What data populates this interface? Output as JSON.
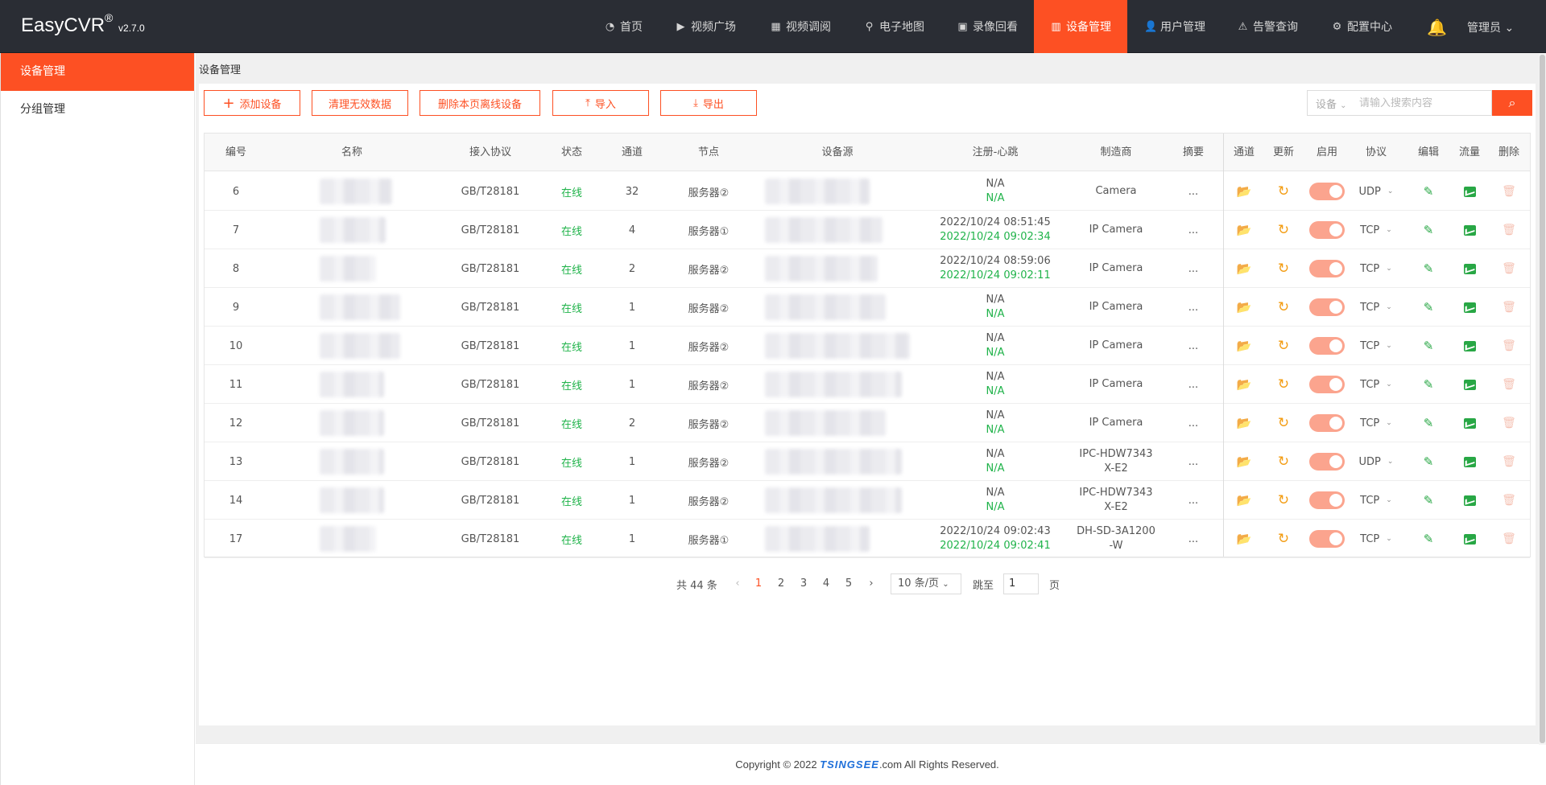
{
  "app": {
    "name": "EasyCVR",
    "reg": "®",
    "version": "v2.7.0"
  },
  "nav": [
    {
      "label": "首页",
      "icon": "dashboard-icon",
      "glyph": "◔"
    },
    {
      "label": "视频广场",
      "icon": "play-circle-icon",
      "glyph": "▶"
    },
    {
      "label": "视频调阅",
      "icon": "grid-view-icon",
      "glyph": "▦"
    },
    {
      "label": "电子地图",
      "icon": "map-pin-icon",
      "glyph": "⚲"
    },
    {
      "label": "录像回看",
      "icon": "video-camera-icon",
      "glyph": "▣"
    },
    {
      "label": "设备管理",
      "icon": "device-list-icon",
      "glyph": "▥",
      "active": true
    },
    {
      "label": "用户管理",
      "icon": "user-icon",
      "glyph": "👤"
    },
    {
      "label": "告警查询",
      "icon": "alarm-icon",
      "glyph": "⚠"
    },
    {
      "label": "配置中心",
      "icon": "gear-icon",
      "glyph": "⚙"
    }
  ],
  "user": {
    "name": "管理员",
    "caret": "⌄"
  },
  "sidebar": [
    {
      "label": "设备管理",
      "active": true
    },
    {
      "label": "分组管理"
    }
  ],
  "breadcrumb": "设备管理",
  "toolbar": {
    "add": "添加设备",
    "add_icon": "+",
    "clean": "清理无效数据",
    "delete_offline": "删除本页离线设备",
    "import": "导入",
    "import_icon": "⤒",
    "export": "导出",
    "export_icon": "⤓"
  },
  "search": {
    "type": "设备",
    "placeholder": "请输入搜索内容",
    "icon": "⌕"
  },
  "columns": [
    "编号",
    "名称",
    "接入协议",
    "状态",
    "通道",
    "节点",
    "设备源",
    "注册-心跳",
    "制造商",
    "摘要",
    "通道",
    "更新",
    "启用",
    "协议",
    "编辑",
    "流量",
    "删除"
  ],
  "rows": [
    {
      "id": "6",
      "protocol": "GB/T28181",
      "status": "在线",
      "channels": "32",
      "node": "服务器②",
      "reg": "N/A",
      "heartbeat": "N/A",
      "mfr1": "Camera",
      "mfr2": "",
      "summary": "...",
      "transport": "UDP"
    },
    {
      "id": "7",
      "protocol": "GB/T28181",
      "status": "在线",
      "channels": "4",
      "node": "服务器①",
      "reg": "2022/10/24 08:51:45",
      "heartbeat": "2022/10/24 09:02:34",
      "mfr1": "IP Camera",
      "mfr2": "",
      "summary": "...",
      "transport": "TCP"
    },
    {
      "id": "8",
      "protocol": "GB/T28181",
      "status": "在线",
      "channels": "2",
      "node": "服务器②",
      "reg": "2022/10/24 08:59:06",
      "heartbeat": "2022/10/24 09:02:11",
      "mfr1": "IP Camera",
      "mfr2": "",
      "summary": "...",
      "transport": "TCP"
    },
    {
      "id": "9",
      "protocol": "GB/T28181",
      "status": "在线",
      "channels": "1",
      "node": "服务器②",
      "reg": "N/A",
      "heartbeat": "N/A",
      "mfr1": "IP Camera",
      "mfr2": "",
      "summary": "...",
      "transport": "TCP"
    },
    {
      "id": "10",
      "protocol": "GB/T28181",
      "status": "在线",
      "channels": "1",
      "node": "服务器②",
      "reg": "N/A",
      "heartbeat": "N/A",
      "mfr1": "IP Camera",
      "mfr2": "",
      "summary": "...",
      "transport": "TCP"
    },
    {
      "id": "11",
      "protocol": "GB/T28181",
      "status": "在线",
      "channels": "1",
      "node": "服务器②",
      "reg": "N/A",
      "heartbeat": "N/A",
      "mfr1": "IP Camera",
      "mfr2": "",
      "summary": "...",
      "transport": "TCP"
    },
    {
      "id": "12",
      "protocol": "GB/T28181",
      "status": "在线",
      "channels": "2",
      "node": "服务器②",
      "reg": "N/A",
      "heartbeat": "N/A",
      "mfr1": "IP Camera",
      "mfr2": "",
      "summary": "...",
      "transport": "TCP"
    },
    {
      "id": "13",
      "protocol": "GB/T28181",
      "status": "在线",
      "channels": "1",
      "node": "服务器②",
      "reg": "N/A",
      "heartbeat": "N/A",
      "mfr1": "IPC-HDW7343",
      "mfr2": "X-E2",
      "summary": "...",
      "transport": "UDP"
    },
    {
      "id": "14",
      "protocol": "GB/T28181",
      "status": "在线",
      "channels": "1",
      "node": "服务器②",
      "reg": "N/A",
      "heartbeat": "N/A",
      "mfr1": "IPC-HDW7343",
      "mfr2": "X-E2",
      "summary": "...",
      "transport": "TCP"
    },
    {
      "id": "17",
      "protocol": "GB/T28181",
      "status": "在线",
      "channels": "1",
      "node": "服务器①",
      "reg": "2022/10/24 09:02:43",
      "heartbeat": "2022/10/24 09:02:41",
      "mfr1": "DH-SD-3A1200",
      "mfr2": "-W",
      "summary": "...",
      "transport": "TCP"
    }
  ],
  "row_icons": {
    "folder": "📂",
    "refresh": "↻",
    "edit": "✎",
    "delete": "🗑",
    "caret": "⌄"
  },
  "pagination": {
    "total": "共 44 条",
    "prev": "‹",
    "next": "›",
    "pages": [
      "1",
      "2",
      "3",
      "4",
      "5"
    ],
    "current": "1",
    "page_size": "10 条/页",
    "page_size_caret": "⌄",
    "jump_label": "跳至",
    "jump_value": "1",
    "jump_suffix": "页"
  },
  "footer": {
    "pre": "Copyright © 2022 ",
    "brand": "TSINGSEE",
    "post": ".com All Rights Reserved."
  },
  "colors": {
    "accent": "#fd5023",
    "online": "#20b34a",
    "topbar": "#2a2d34"
  }
}
